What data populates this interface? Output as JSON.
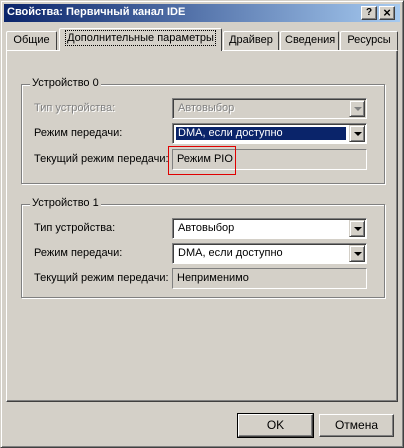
{
  "window": {
    "title": "Свойства: Первичный канал IDE",
    "help_button": "?",
    "close_button": "×"
  },
  "tabs": [
    {
      "label": "Общие",
      "active": false
    },
    {
      "label": "Дополнительные параметры",
      "active": true
    },
    {
      "label": "Драйвер",
      "active": false
    },
    {
      "label": "Сведения",
      "active": false
    },
    {
      "label": "Ресурсы",
      "active": false
    }
  ],
  "device0": {
    "legend": "Устройство 0",
    "type_label": "Тип устройства:",
    "type_value": "Автовыбор",
    "type_enabled": false,
    "mode_label": "Режим передачи:",
    "mode_value": "DMA, если доступно",
    "current_label": "Текущий режим передачи:",
    "current_value": "Режим PIO"
  },
  "device1": {
    "legend": "Устройство 1",
    "type_label": "Тип устройства:",
    "type_value": "Автовыбор",
    "mode_label": "Режим передачи:",
    "mode_value": "DMA, если доступно",
    "current_label": "Текущий режим передачи:",
    "current_value": "Неприменимо"
  },
  "buttons": {
    "ok": "OK",
    "cancel": "Отмена"
  },
  "colors": {
    "face": "#d4d0c8",
    "title_start": "#0a246a",
    "title_end": "#a6caf0",
    "selection": "#0a246a",
    "annotation": "#e00000"
  }
}
